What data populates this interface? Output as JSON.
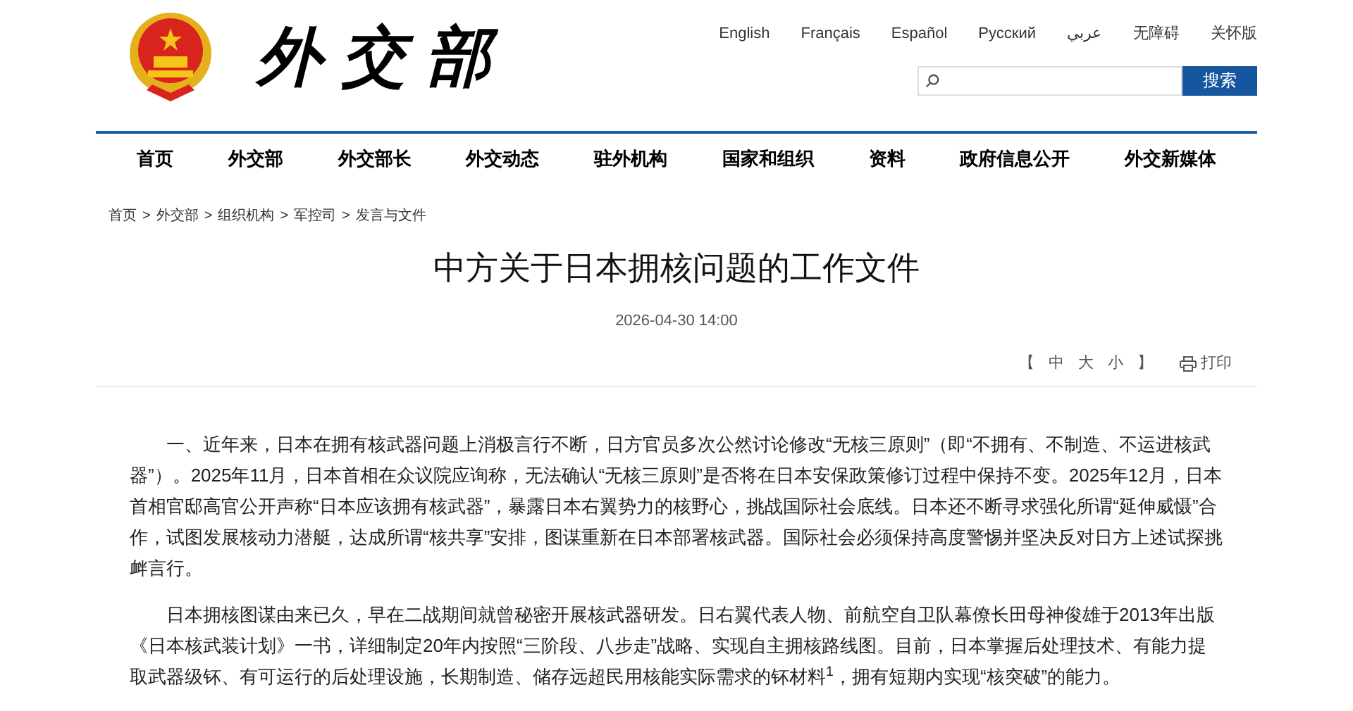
{
  "header": {
    "logo_text": "外交部",
    "languages": [
      "English",
      "Français",
      "Español",
      "Русский",
      "عربي",
      "无障碍",
      "关怀版"
    ],
    "search": {
      "button": "搜索"
    }
  },
  "nav": [
    "首页",
    "外交部",
    "外交部长",
    "外交动态",
    "驻外机构",
    "国家和组织",
    "资料",
    "政府信息公开",
    "外交新媒体"
  ],
  "breadcrumb": {
    "items": [
      "首页",
      "外交部",
      "组织机构",
      "军控司",
      "发言与文件"
    ],
    "separator": ">"
  },
  "article": {
    "title": "中方关于日本拥核问题的工作文件",
    "date": "2026-04-30 14:00",
    "font_size": {
      "open": "【",
      "options": [
        "中",
        "大",
        "小"
      ],
      "close": "】"
    },
    "print": "打印",
    "paragraphs": [
      "一、近年来，日本在拥有核武器问题上消极言行不断，日方官员多次公然讨论修改“无核三原则”（即“不拥有、不制造、不运进核武器”）。2025年11月，日本首相在众议院应询称，无法确认“无核三原则”是否将在日本安保政策修订过程中保持不变。2025年12月，日本首相官邸高官公开声称“日本应该拥有核武器”，暴露日本右翼势力的核野心，挑战国际社会底线。日本还不断寻求强化所谓“延伸威慑”合作，试图发展核动力潜艇，达成所谓“核共享”安排，图谋重新在日本部署核武器。国际社会必须保持高度警惕并坚决反对日方上述试探挑衅言行。",
      "日本拥核图谋由来已久，早在二战期间就曾秘密开展核武器研发。日右翼代表人物、前航空自卫队幕僚长田母神俊雄于2013年出版《日本核武装计划》一书，详细制定20年内按照“三阶段、八步走”战略、实现自主拥核路线图。目前，日本掌握后处理技术、有能力提取武器级钚、有可运行的后处理设施，长期制造、储存远超民用核能实际需求的钚材料$^{1}$，拥有短期内实现“核突破”的能力。"
    ]
  }
}
